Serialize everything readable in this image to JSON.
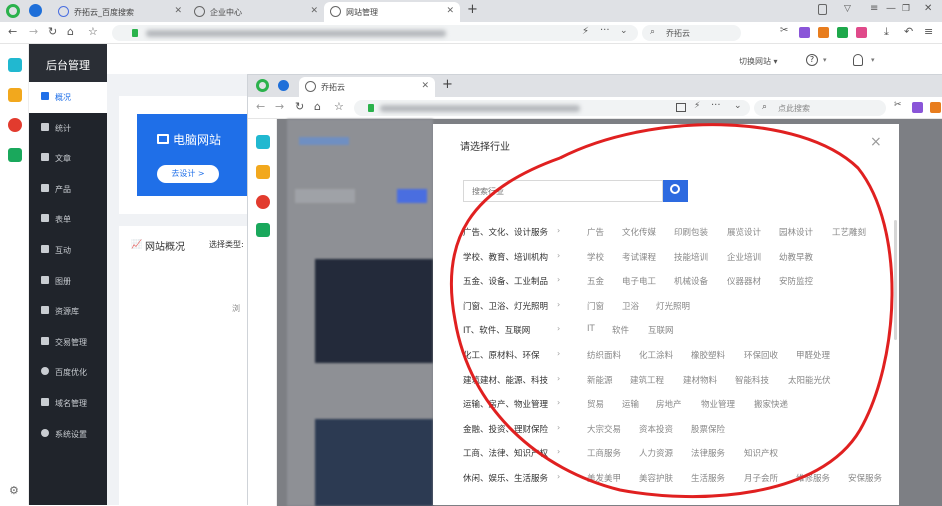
{
  "browser": {
    "tabs": [
      {
        "title": "乔拓云_百度搜索"
      },
      {
        "title": "企业中心"
      },
      {
        "title": "网站管理"
      }
    ],
    "new_tab": "+",
    "search_text": "乔拓云"
  },
  "admin": {
    "title": "后台管理",
    "nav": [
      "概况",
      "统计",
      "文章",
      "产品",
      "表单",
      "互动",
      "图册",
      "资源库",
      "交易管理",
      "百度优化",
      "域名管理",
      "系统设置"
    ],
    "switch_site": "切换网站",
    "help_icon": "?",
    "card_title": "电脑网站",
    "card_button": "去设计 >",
    "overview_title": "网站概况",
    "overview_select": "选择类型:",
    "overview_stub": "浏"
  },
  "browser2": {
    "tab_title": "乔拓云",
    "search_placeholder": "点此搜索"
  },
  "modal": {
    "title": "请选择行业",
    "search_placeholder": "搜索行业",
    "close": "×",
    "rows": [
      {
        "category": "广告、文化、设计服务",
        "subs": [
          "广告",
          "文化传媒",
          "印刷包装",
          "展览设计",
          "园林设计",
          "工艺雕刻"
        ]
      },
      {
        "category": "学校、教育、培训机构",
        "subs": [
          "学校",
          "考试课程",
          "技能培训",
          "企业培训",
          "幼教早教"
        ]
      },
      {
        "category": "五金、设备、工业制品",
        "subs": [
          "五金",
          "电子电工",
          "机械设备",
          "仪器器材",
          "安防监控"
        ]
      },
      {
        "category": "门窗、卫浴、灯光照明",
        "subs": [
          "门窗",
          "卫浴",
          "灯光照明"
        ]
      },
      {
        "category": "IT、软件、互联网",
        "subs": [
          "IT",
          "软件",
          "互联网"
        ]
      },
      {
        "category": "化工、原材料、环保",
        "subs": [
          "纺织面料",
          "化工涂料",
          "橡胶塑料",
          "环保回收",
          "甲醛处理"
        ]
      },
      {
        "category": "建筑建材、能源、科技",
        "subs": [
          "新能源",
          "建筑工程",
          "建材物料",
          "智能科技",
          "太阳能光伏"
        ]
      },
      {
        "category": "运输、房产、物业管理",
        "subs": [
          "贸易",
          "运输",
          "房地产",
          "物业管理",
          "搬家快递"
        ]
      },
      {
        "category": "金融、投资、理财保险",
        "subs": [
          "大宗交易",
          "资本投资",
          "股票保险"
        ]
      },
      {
        "category": "工商、法律、知识产权",
        "subs": [
          "工商服务",
          "人力资源",
          "法律服务",
          "知识产权"
        ]
      },
      {
        "category": "休闲、娱乐、生活服务",
        "subs": [
          "美发美甲",
          "美容护肤",
          "生活服务",
          "月子会所",
          "维修服务",
          "安保服务"
        ]
      }
    ]
  },
  "colors": {
    "accent": "#1f6fe8",
    "sidebar": "#20242b",
    "annotation": "#e02020"
  }
}
